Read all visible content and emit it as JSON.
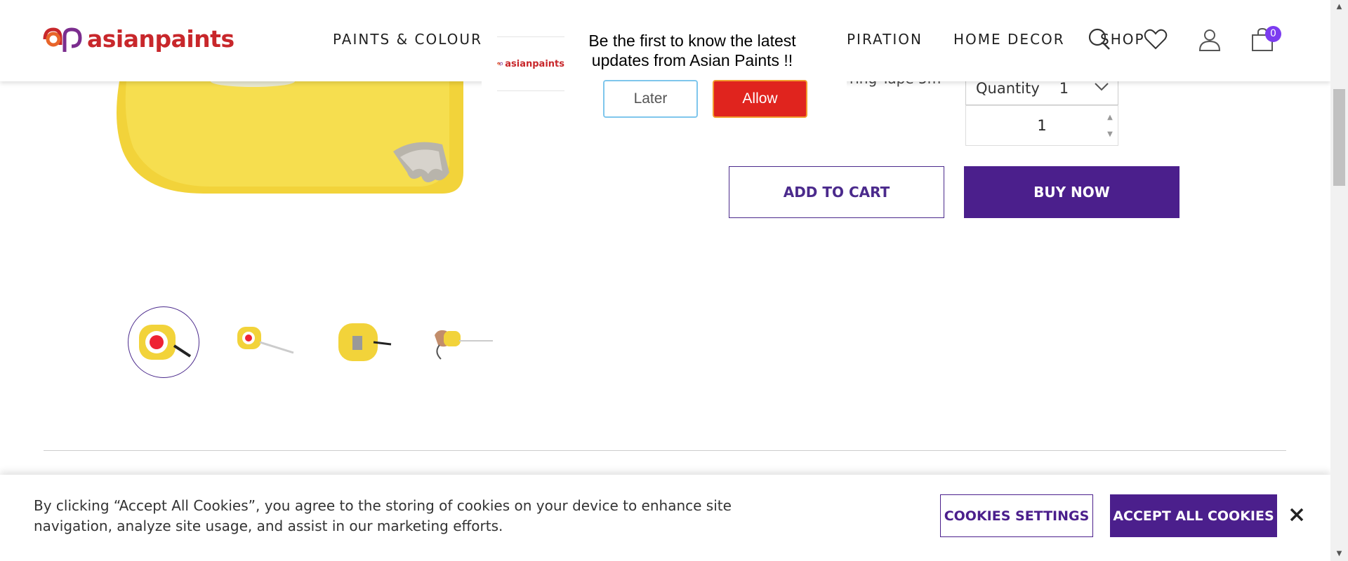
{
  "header": {
    "logo_text": "asianpaints",
    "nav": [
      {
        "label": "PAINTS & COLOUR"
      },
      {
        "label": "PIRATION"
      },
      {
        "label": "HOME DECOR"
      },
      {
        "label": "SHOP"
      }
    ],
    "cart_count": "0",
    "icons": [
      "search-icon",
      "wishlist-heart-icon",
      "account-user-icon",
      "cart-bag-icon"
    ]
  },
  "product": {
    "name_partial": "ring Tape 5m",
    "quantity_label": "Quantity",
    "quantity_selected": "1",
    "quantity_input_value": "1",
    "add_to_cart_label": "ADD TO CART",
    "buy_now_label": "BUY NOW",
    "thumbnails": [
      "measuring-tape-front",
      "measuring-tape-extended",
      "measuring-tape-back",
      "measuring-tape-in-hand"
    ]
  },
  "push_prompt": {
    "logo_text": "asianpaints",
    "message": "Be the first to know the latest updates from Asian Paints !!",
    "later_label": "Later",
    "allow_label": "Allow"
  },
  "cookie_banner": {
    "text": "By clicking “Accept All Cookies”, you agree to the storing of cookies on your device to enhance site navigation, analyze site usage, and assist in our marketing efforts.",
    "settings_label": "COOKIES SETTINGS",
    "accept_label": "ACCEPT ALL COOKIES",
    "close_label": "✕"
  },
  "colors": {
    "brand_purple": "#4b1f8c",
    "brand_red": "#c8272b",
    "badge_purple": "#7c3cf0",
    "allow_red": "#e0241e",
    "product_yellow": "#f2d33a"
  }
}
